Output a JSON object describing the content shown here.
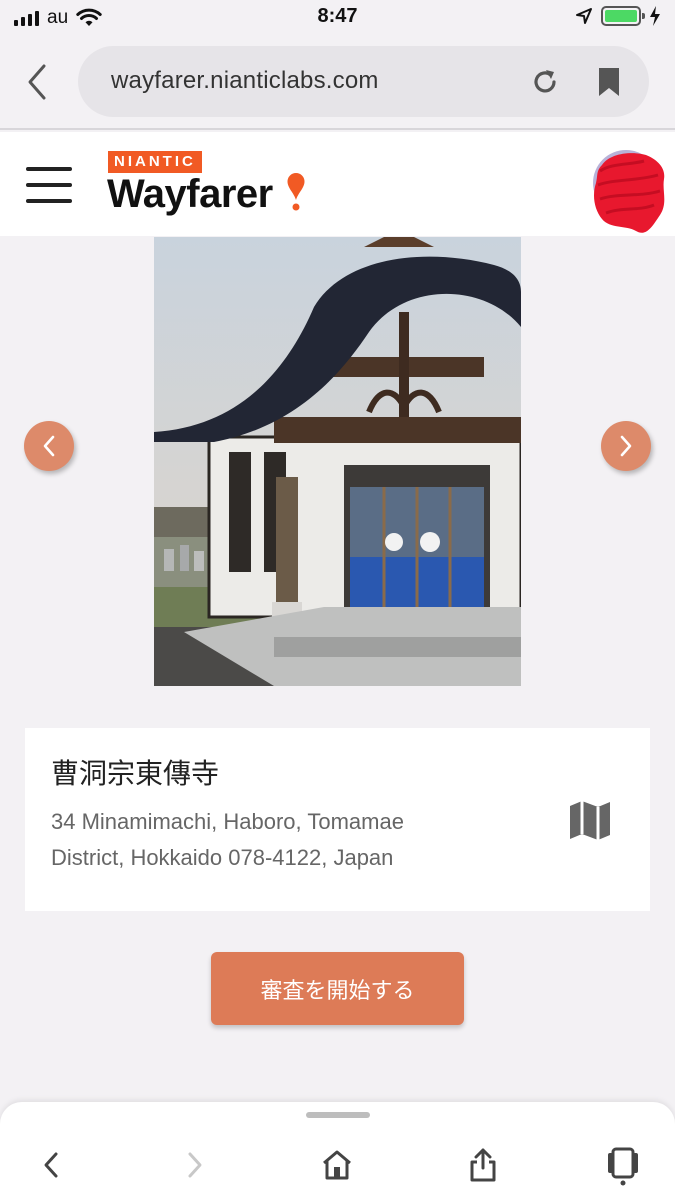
{
  "status_bar": {
    "carrier": "au",
    "time": "8:47",
    "battery_level": 1.0
  },
  "browser": {
    "url": "wayfarer.nianticlabs.com",
    "icons": [
      "back-chevron-icon",
      "reload-icon",
      "bookmark-icon"
    ]
  },
  "app_header": {
    "brand_badge": "NIANTIC",
    "brand_name": "Wayfarer",
    "icons": [
      "hamburger-menu-icon",
      "location-pin-icon",
      "avatar"
    ]
  },
  "colors": {
    "niantic_orange": "#f15a24",
    "accent_button": "#dd7b57",
    "arrow_button": "#dd8a6a",
    "background": "#f3f1f4"
  },
  "candidate": {
    "title": "曹洞宗東傳寺",
    "address": "34 Minamimachi, Haboro, Tomamae District, Hokkaido 078-4122, Japan",
    "map_icon": "map-icon"
  },
  "actions": {
    "start_review_label": "審査を開始する"
  },
  "bottom_toolbar": {
    "icons": [
      "back-icon",
      "forward-icon",
      "home-icon",
      "share-icon",
      "tabs-icon"
    ]
  }
}
